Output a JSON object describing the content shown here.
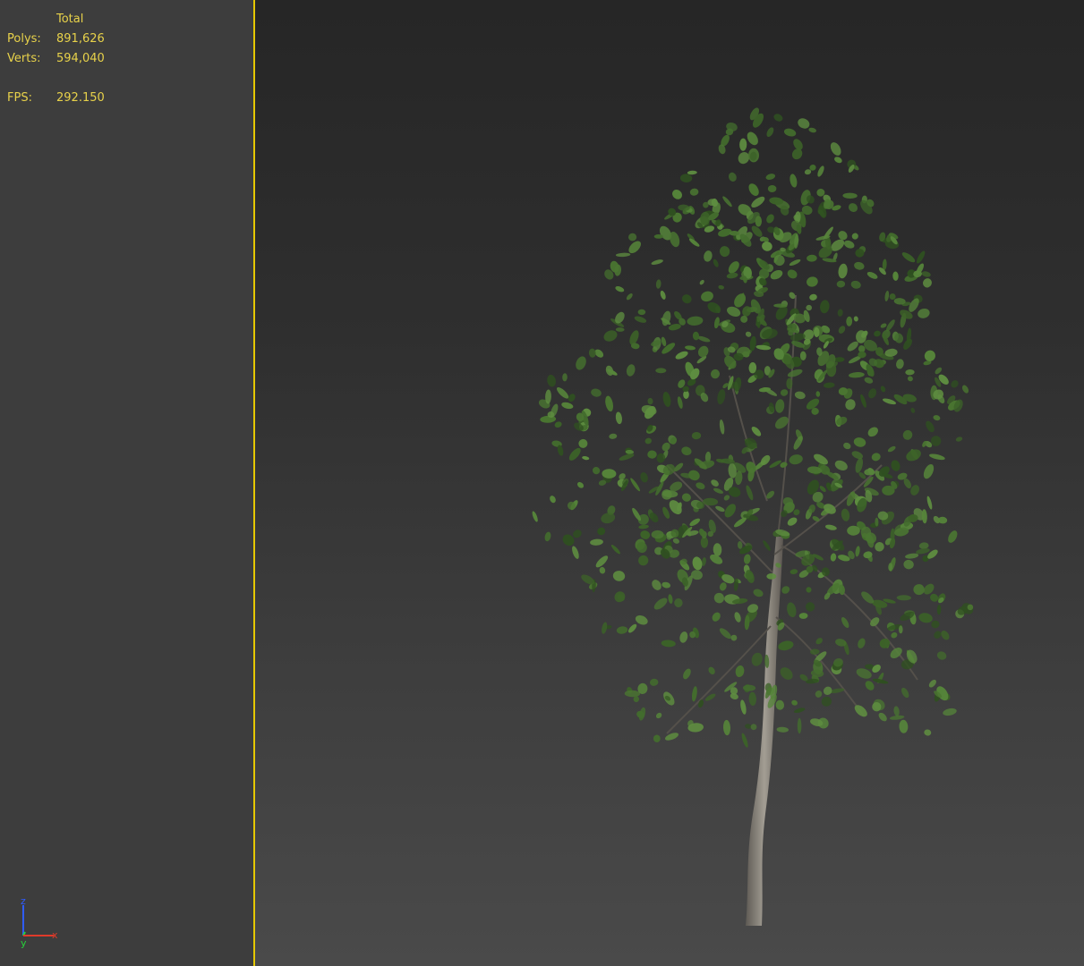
{
  "viewport_stats": {
    "header": "Total",
    "polys_label": "Polys:",
    "polys_value": "891,626",
    "verts_label": "Verts:",
    "verts_value": "594,040",
    "fps_label": "FPS:",
    "fps_value": "292.150"
  },
  "axis_gizmo": {
    "z_label": "z",
    "y_label": "y",
    "x_label": "x"
  },
  "colors": {
    "stats_text": "#e8d24a",
    "divider": "#e6c800",
    "axis_z": "#2f5cff",
    "axis_y": "#26d13a",
    "axis_x": "#e03a2a",
    "foliage": "#4d7a34",
    "trunk": "#8a857c"
  },
  "viewport_content": {
    "object": "tree-model"
  }
}
